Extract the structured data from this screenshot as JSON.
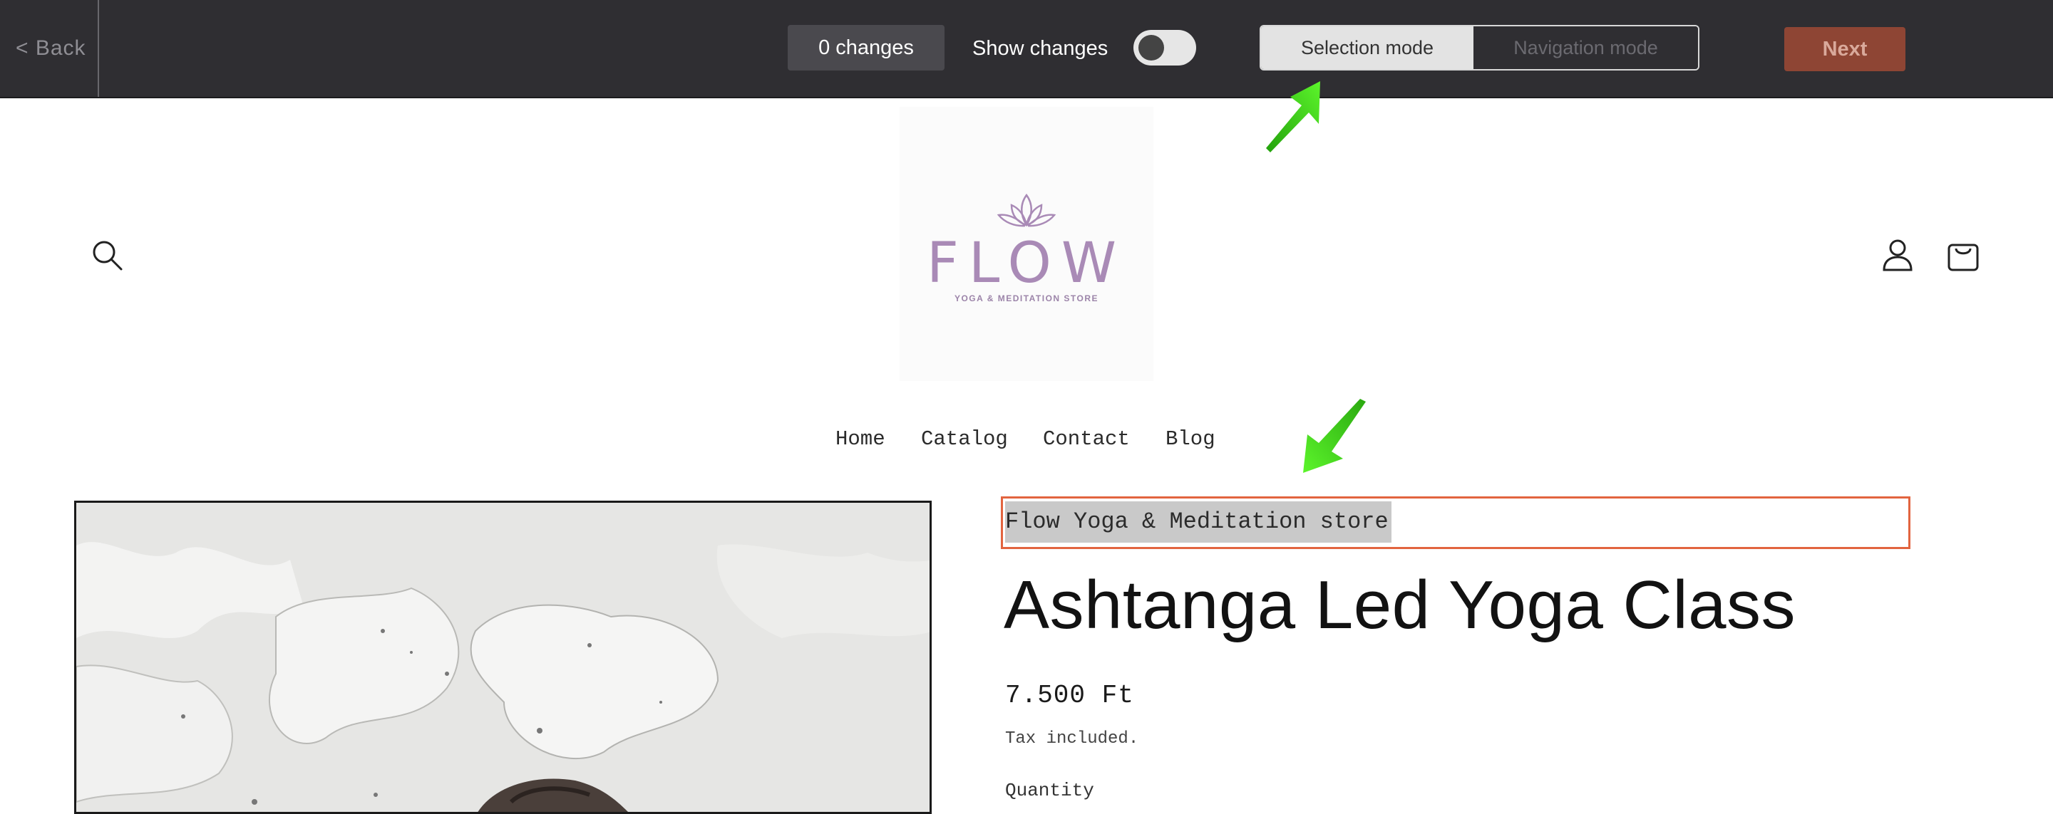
{
  "toolbar": {
    "back_label": "< Back",
    "changes_label": "0 changes",
    "show_changes_label": "Show changes",
    "show_changes_on": false,
    "mode_selection_label": "Selection mode",
    "mode_navigation_label": "Navigation mode",
    "active_mode": "Selection mode",
    "next_label": "Next"
  },
  "store": {
    "logo_word": "FLOW",
    "logo_tagline": "YOGA & MEDITATION STORE",
    "nav": [
      "Home",
      "Catalog",
      "Contact",
      "Blog"
    ],
    "icons": [
      "search-icon",
      "account-icon",
      "cart-icon",
      "lotus-icon"
    ]
  },
  "product": {
    "vendor": "Flow Yoga & Meditation store",
    "title": "Ashtanga Led Yoga Class",
    "price": "7.500 Ft",
    "tax_note": "Tax included.",
    "quantity_label": "Quantity"
  },
  "colors": {
    "toolbar_bg": "#2f2e32",
    "next_bg": "#8e4534",
    "selection_outline": "#e2643f",
    "logo_purple": "#a98ab6",
    "annotation_arrow": "#3fe01a"
  }
}
